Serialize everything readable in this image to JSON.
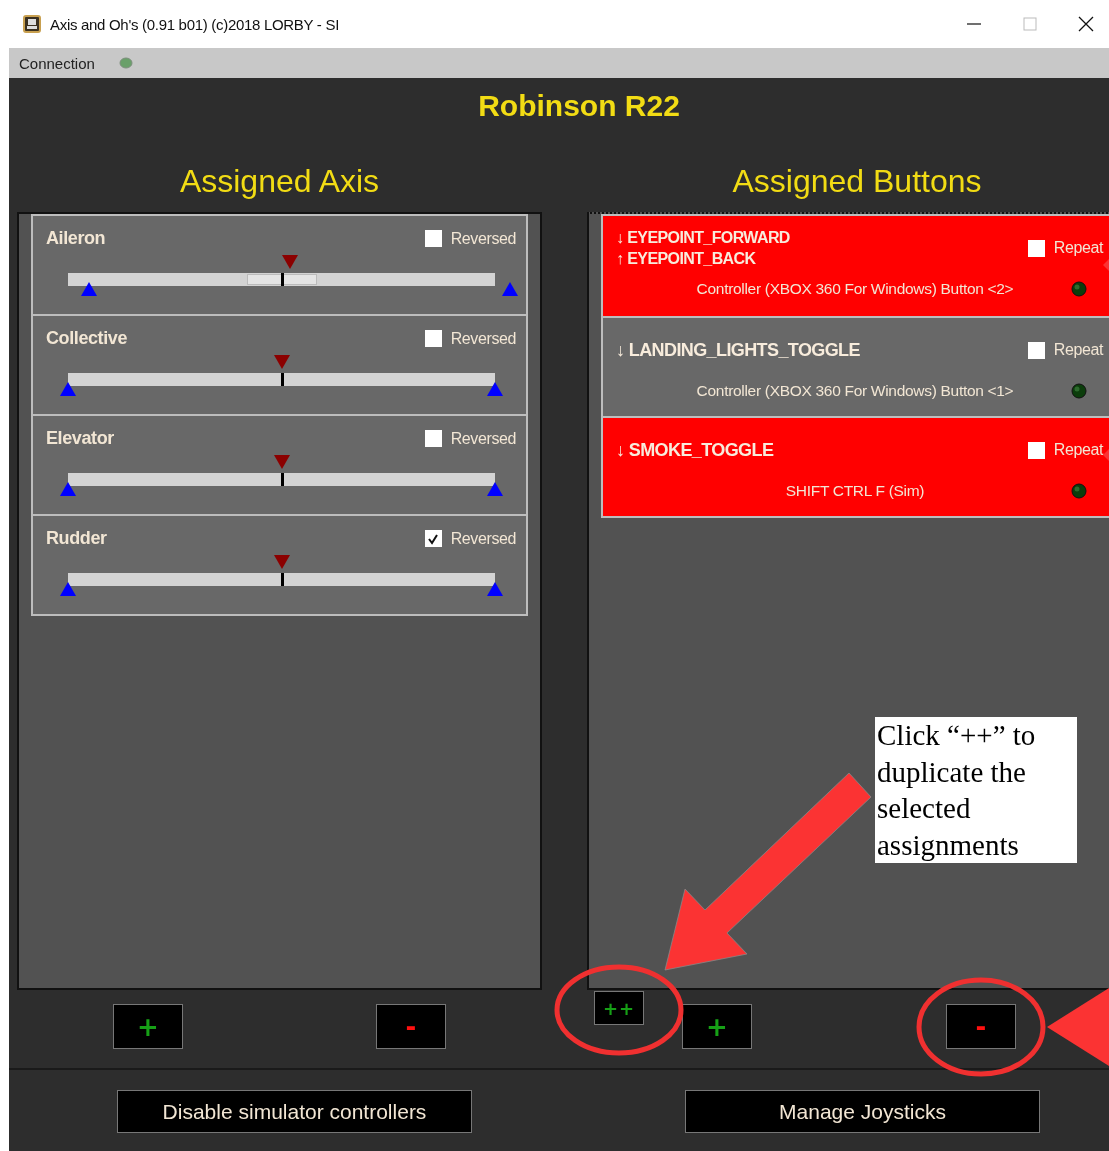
{
  "window": {
    "title": "Axis and Oh's (0.91 b01) (c)2018 LORBY - SI"
  },
  "menu": [
    {
      "label": "Connection"
    }
  ],
  "profile": "Robinson R22",
  "axes_panel": {
    "title": "Assigned Axis",
    "add_button": "+",
    "remove_button": "-",
    "axes": [
      {
        "name": "Aileron",
        "kind": "deadzone",
        "reversed_label": "Reversed",
        "reversed": false,
        "level": 0.52
      },
      {
        "name": "Collective",
        "kind": "plain",
        "reversed_label": "Reversed",
        "reversed": false,
        "level": 0.5
      },
      {
        "name": "Elevator",
        "kind": "plain",
        "reversed_label": "Reversed",
        "reversed": false,
        "level": 0.5
      },
      {
        "name": "Rudder",
        "kind": "plain",
        "reversed_label": "Reversed",
        "reversed": true,
        "level": 0.5
      }
    ]
  },
  "buttons_panel": {
    "title": "Assigned Buttons",
    "duplicate_button": "++",
    "add_button": "+",
    "remove_button": "-",
    "assignments": [
      {
        "selected": true,
        "commands": [
          "↓ EYEPOINT_FORWARD",
          "↑ EYEPOINT_BACK"
        ],
        "repeat_label": "Repeat",
        "repeat": false,
        "source": "Controller (XBOX 360 For Windows) Button <2>"
      },
      {
        "selected": false,
        "commands": [
          "↓ LANDING_LIGHTS_TOGGLE"
        ],
        "repeat_label": "Repeat",
        "repeat": false,
        "source": "Controller (XBOX 360 For Windows) Button <1>"
      },
      {
        "selected": true,
        "commands": [
          "↓ SMOKE_TOGGLE"
        ],
        "repeat_label": "Repeat",
        "repeat": false,
        "source": "SHIFT CTRL F (Sim)"
      }
    ]
  },
  "footer": {
    "buttons": [
      "Disable simulator controllers",
      "Manage Joysticks"
    ]
  },
  "callout": {
    "text": "Click “++” to duplicate the selected assignments"
  }
}
